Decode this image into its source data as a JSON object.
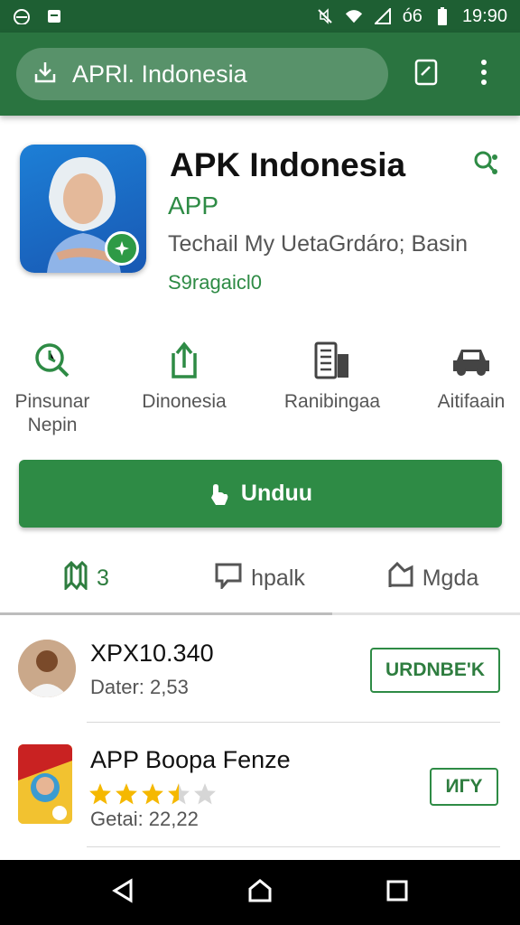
{
  "status_bar": {
    "time": "19:90",
    "battery_text": "ó6",
    "icons": [
      "android-icon",
      "sim-icon",
      "mute-icon",
      "wifi-icon",
      "signal-icon",
      "battery-icon"
    ]
  },
  "app_bar": {
    "url": "APRl. Indonesia",
    "icons": [
      "download-icon",
      "document-icon",
      "more-vert-icon"
    ]
  },
  "app": {
    "title": "APK Indonesia",
    "category": "APP",
    "developer": "Techail My UetaGrdáro; Basin",
    "tag": "S9ragaicl0"
  },
  "stats": [
    {
      "label": "Pinsunar\nNepin",
      "icon": "search-clock-icon"
    },
    {
      "label": "Dinonesia",
      "icon": "upload-icon"
    },
    {
      "label": "Ranibingaa",
      "icon": "document-icon"
    },
    {
      "label": "Aitifaain",
      "icon": "car-icon"
    }
  ],
  "install_button": {
    "label": "Unduu",
    "icon": "hand-icon"
  },
  "tabs": [
    {
      "label": "3",
      "icon": "map-icon",
      "active": true
    },
    {
      "label": "hpalk",
      "icon": "comment-icon",
      "active": false
    },
    {
      "label": "Mgda",
      "icon": "flag-icon",
      "active": false
    }
  ],
  "list": [
    {
      "title": "XPX10.340",
      "subtitle": "Dater: 2,53",
      "button": "URDNBE'K"
    },
    {
      "title": "APP Boopa Fenze",
      "subtitle": "Getai: 22,22",
      "button": "ИГY",
      "rating": 3.5,
      "rating_max": 5
    }
  ],
  "colors": {
    "primary": "#2a7440",
    "status_bar": "#1e5f33",
    "accent": "#2e8b45",
    "star": "#f5b800"
  }
}
